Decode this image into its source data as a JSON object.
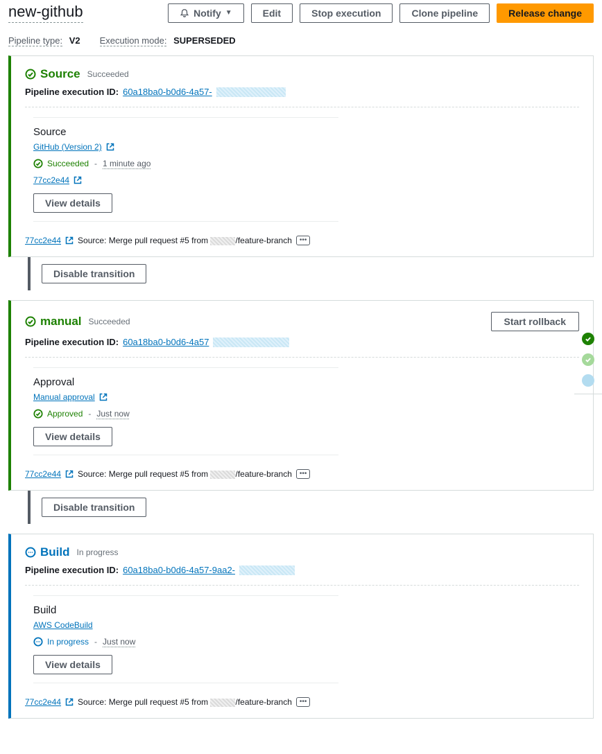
{
  "header": {
    "title": "new-github",
    "buttons": {
      "notify": "Notify",
      "edit": "Edit",
      "stop": "Stop execution",
      "clone": "Clone pipeline",
      "release": "Release change"
    },
    "meta": {
      "pipeline_type_label": "Pipeline type:",
      "pipeline_type_value": "V2",
      "execution_mode_label": "Execution mode:",
      "execution_mode_value": "SUPERSEDED"
    }
  },
  "stages": {
    "source": {
      "name": "Source",
      "status": "Succeeded",
      "exec_label": "Pipeline execution ID:",
      "exec_id": "60a18ba0-b0d6-4a57-",
      "action": {
        "title": "Source",
        "provider": "GitHub (Version 2)",
        "status": "Succeeded",
        "time": "1 minute ago",
        "commit": "77cc2e44",
        "view_details": "View details"
      },
      "footer": {
        "commit": "77cc2e44",
        "msg_prefix": "Source: Merge pull request #5 from ",
        "msg_suffix": "/feature-branch"
      }
    },
    "manual": {
      "name": "manual",
      "status": "Succeeded",
      "rollback": "Start rollback",
      "exec_label": "Pipeline execution ID:",
      "exec_id": "60a18ba0-b0d6-4a57",
      "action": {
        "title": "Approval",
        "provider": "Manual approval",
        "status": "Approved",
        "time": "Just now",
        "view_details": "View details"
      },
      "footer": {
        "commit": "77cc2e44",
        "msg_prefix": "Source: Merge pull request #5 from ",
        "msg_suffix": "/feature-branch"
      }
    },
    "build": {
      "name": "Build",
      "status": "In progress",
      "exec_label": "Pipeline execution ID:",
      "exec_id": "60a18ba0-b0d6-4a57-9aa2-",
      "action": {
        "title": "Build",
        "provider": "AWS CodeBuild",
        "status": "In progress",
        "time": "Just now",
        "view_details": "View details"
      },
      "footer": {
        "commit": "77cc2e44",
        "msg_prefix": "Source: Merge pull request #5 from ",
        "msg_suffix": "/feature-branch"
      }
    }
  },
  "transition": {
    "disable": "Disable transition"
  }
}
